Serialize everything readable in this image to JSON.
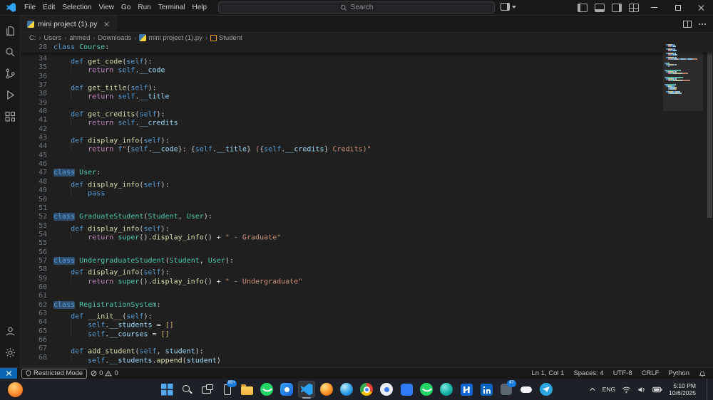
{
  "titlebar": {
    "menus": [
      "File",
      "Edit",
      "Selection",
      "View",
      "Go",
      "Run",
      "Terminal",
      "Help"
    ],
    "search_placeholder": "Search"
  },
  "tab": {
    "label": "mini project (1).py"
  },
  "breadcrumbs": {
    "items": [
      {
        "label": "C:"
      },
      {
        "label": "Users"
      },
      {
        "label": "ahmed"
      },
      {
        "label": "Downloads"
      },
      {
        "label": "mini project (1).py",
        "icon": "python"
      },
      {
        "label": "Student",
        "icon": "class"
      }
    ]
  },
  "editor": {
    "token_colors": {
      "kw": "#569cd6",
      "ret": "#c586c0",
      "cls": "#4ec9b0",
      "fn": "#dcdcaa",
      "sv": "#569cd6",
      "va": "#9cdcfe",
      "st": "#ce9178",
      "pu": "#cccccc",
      "op": "#d4d4d4",
      "bk": "#d9b879",
      "hl": "#569cd6"
    },
    "sticky": {
      "n": 28,
      "t": [
        [
          "kw",
          "class "
        ],
        [
          "cls",
          "Course"
        ],
        [
          "pu",
          ":"
        ]
      ]
    },
    "lines": [
      {
        "n": 34,
        "t": [
          [
            "ind",
            1
          ],
          [
            "kw",
            "def "
          ],
          [
            "fn",
            "get_code"
          ],
          [
            "pu",
            "("
          ],
          [
            "sv",
            "self"
          ],
          [
            "pu",
            "):"
          ]
        ]
      },
      {
        "n": 35,
        "t": [
          [
            "ind",
            2
          ],
          [
            "ret",
            "return "
          ],
          [
            "sv",
            "self"
          ],
          [
            "pu",
            "."
          ],
          [
            "va",
            "__code"
          ]
        ]
      },
      {
        "n": 36,
        "t": []
      },
      {
        "n": 37,
        "t": [
          [
            "ind",
            1
          ],
          [
            "kw",
            "def "
          ],
          [
            "fn",
            "get_title"
          ],
          [
            "pu",
            "("
          ],
          [
            "sv",
            "self"
          ],
          [
            "pu",
            "):"
          ]
        ]
      },
      {
        "n": 38,
        "t": [
          [
            "ind",
            2
          ],
          [
            "ret",
            "return "
          ],
          [
            "sv",
            "self"
          ],
          [
            "pu",
            "."
          ],
          [
            "va",
            "__title"
          ]
        ]
      },
      {
        "n": 39,
        "t": []
      },
      {
        "n": 40,
        "t": [
          [
            "ind",
            1
          ],
          [
            "kw",
            "def "
          ],
          [
            "fn",
            "get_credits"
          ],
          [
            "pu",
            "("
          ],
          [
            "sv",
            "self"
          ],
          [
            "pu",
            "):"
          ]
        ]
      },
      {
        "n": 41,
        "t": [
          [
            "ind",
            2
          ],
          [
            "ret",
            "return "
          ],
          [
            "sv",
            "self"
          ],
          [
            "pu",
            "."
          ],
          [
            "va",
            "__credits"
          ]
        ]
      },
      {
        "n": 42,
        "t": []
      },
      {
        "n": 43,
        "t": [
          [
            "ind",
            1
          ],
          [
            "kw",
            "def "
          ],
          [
            "fn",
            "display_info"
          ],
          [
            "pu",
            "("
          ],
          [
            "sv",
            "self"
          ],
          [
            "pu",
            "):"
          ]
        ]
      },
      {
        "n": 44,
        "t": [
          [
            "ind",
            2
          ],
          [
            "ret",
            "return "
          ],
          [
            "kw",
            "f"
          ],
          [
            "st",
            "\""
          ],
          [
            "pu",
            "{"
          ],
          [
            "sv",
            "self"
          ],
          [
            "pu",
            "."
          ],
          [
            "va",
            "__code"
          ],
          [
            "pu",
            "}"
          ],
          [
            "st",
            ": "
          ],
          [
            "pu",
            "{"
          ],
          [
            "sv",
            "self"
          ],
          [
            "pu",
            "."
          ],
          [
            "va",
            "__title"
          ],
          [
            "pu",
            "}"
          ],
          [
            "st",
            " ("
          ],
          [
            "pu",
            "{"
          ],
          [
            "sv",
            "self"
          ],
          [
            "pu",
            "."
          ],
          [
            "va",
            "__credits"
          ],
          [
            "pu",
            "}"
          ],
          [
            "st",
            " Credits)\""
          ]
        ]
      },
      {
        "n": 45,
        "t": []
      },
      {
        "n": 46,
        "t": []
      },
      {
        "n": 47,
        "t": [
          [
            "hl",
            "class"
          ],
          [
            "pu",
            " "
          ],
          [
            "cls",
            "User"
          ],
          [
            "pu",
            ":"
          ]
        ]
      },
      {
        "n": 48,
        "t": [
          [
            "ind",
            1
          ],
          [
            "kw",
            "def "
          ],
          [
            "fn",
            "display_info"
          ],
          [
            "pu",
            "("
          ],
          [
            "sv",
            "self"
          ],
          [
            "pu",
            "):"
          ]
        ]
      },
      {
        "n": 49,
        "t": [
          [
            "ind",
            2
          ],
          [
            "kw",
            "pass"
          ]
        ]
      },
      {
        "n": 50,
        "t": []
      },
      {
        "n": 51,
        "t": []
      },
      {
        "n": 52,
        "t": [
          [
            "hl",
            "class"
          ],
          [
            "pu",
            " "
          ],
          [
            "cls",
            "GraduateStudent"
          ],
          [
            "pu",
            "("
          ],
          [
            "cls",
            "Student"
          ],
          [
            "pu",
            ", "
          ],
          [
            "cls",
            "User"
          ],
          [
            "pu",
            "):"
          ]
        ]
      },
      {
        "n": 53,
        "t": [
          [
            "ind",
            1
          ],
          [
            "kw",
            "def "
          ],
          [
            "fn",
            "display_info"
          ],
          [
            "pu",
            "("
          ],
          [
            "sv",
            "self"
          ],
          [
            "pu",
            "):"
          ]
        ]
      },
      {
        "n": 54,
        "t": [
          [
            "ind",
            2
          ],
          [
            "ret",
            "return "
          ],
          [
            "cls",
            "super"
          ],
          [
            "pu",
            "()."
          ],
          [
            "fn",
            "display_info"
          ],
          [
            "pu",
            "() "
          ],
          [
            "op",
            "+ "
          ],
          [
            "st",
            "\" - Graduate\""
          ]
        ]
      },
      {
        "n": 55,
        "t": []
      },
      {
        "n": 56,
        "t": []
      },
      {
        "n": 57,
        "t": [
          [
            "hl",
            "class"
          ],
          [
            "pu",
            " "
          ],
          [
            "cls",
            "UndergraduateStudent"
          ],
          [
            "pu",
            "("
          ],
          [
            "cls",
            "Student"
          ],
          [
            "pu",
            ", "
          ],
          [
            "cls",
            "User"
          ],
          [
            "pu",
            "):"
          ]
        ]
      },
      {
        "n": 58,
        "t": [
          [
            "ind",
            1
          ],
          [
            "kw",
            "def "
          ],
          [
            "fn",
            "display_info"
          ],
          [
            "pu",
            "("
          ],
          [
            "sv",
            "self"
          ],
          [
            "pu",
            "):"
          ]
        ]
      },
      {
        "n": 59,
        "t": [
          [
            "ind",
            2
          ],
          [
            "ret",
            "return "
          ],
          [
            "cls",
            "super"
          ],
          [
            "pu",
            "()."
          ],
          [
            "fn",
            "display_info"
          ],
          [
            "pu",
            "() "
          ],
          [
            "op",
            "+ "
          ],
          [
            "st",
            "\" - Undergraduate\""
          ]
        ]
      },
      {
        "n": 60,
        "t": []
      },
      {
        "n": 61,
        "t": []
      },
      {
        "n": 62,
        "t": [
          [
            "hl",
            "class"
          ],
          [
            "pu",
            " "
          ],
          [
            "cls",
            "RegistrationSystem"
          ],
          [
            "pu",
            ":"
          ]
        ]
      },
      {
        "n": 63,
        "t": [
          [
            "ind",
            1
          ],
          [
            "kw",
            "def "
          ],
          [
            "fn",
            "__init__"
          ],
          [
            "pu",
            "("
          ],
          [
            "sv",
            "self"
          ],
          [
            "pu",
            "):"
          ]
        ]
      },
      {
        "n": 64,
        "t": [
          [
            "ind",
            2
          ],
          [
            "sv",
            "self"
          ],
          [
            "pu",
            "."
          ],
          [
            "va",
            "__students"
          ],
          [
            "op",
            " = "
          ],
          [
            "bk",
            "[]"
          ]
        ]
      },
      {
        "n": 65,
        "t": [
          [
            "ind",
            2
          ],
          [
            "sv",
            "self"
          ],
          [
            "pu",
            "."
          ],
          [
            "va",
            "__courses"
          ],
          [
            "op",
            " = "
          ],
          [
            "bk",
            "[]"
          ]
        ]
      },
      {
        "n": 66,
        "t": []
      },
      {
        "n": 67,
        "t": [
          [
            "ind",
            1
          ],
          [
            "kw",
            "def "
          ],
          [
            "fn",
            "add_student"
          ],
          [
            "pu",
            "("
          ],
          [
            "sv",
            "self"
          ],
          [
            "pu",
            ", "
          ],
          [
            "va",
            "student"
          ],
          [
            "pu",
            "):"
          ]
        ]
      },
      {
        "n": 68,
        "t": [
          [
            "ind",
            2
          ],
          [
            "sv",
            "self"
          ],
          [
            "pu",
            "."
          ],
          [
            "va",
            "__students"
          ],
          [
            "pu",
            "."
          ],
          [
            "fn",
            "append"
          ],
          [
            "pu",
            "("
          ],
          [
            "va",
            "student"
          ],
          [
            "pu",
            ")"
          ]
        ]
      }
    ]
  },
  "status_bar": {
    "restricted_label": "Restricted Mode",
    "errors": "0",
    "warnings": "0",
    "line_col": "Ln 1, Col 1",
    "spaces": "Spaces: 4",
    "encoding": "UTF-8",
    "eol": "CRLF",
    "language": "Python"
  },
  "taskbar": {
    "apps": [
      {
        "name": "start"
      },
      {
        "name": "search"
      },
      {
        "name": "task-view"
      },
      {
        "name": "phone-link",
        "badge": "99+"
      },
      {
        "name": "file-explorer"
      },
      {
        "name": "whatsapp"
      },
      {
        "name": "app-blue"
      },
      {
        "name": "vscode",
        "active": true
      },
      {
        "name": "app-candy"
      },
      {
        "name": "app-sphere"
      },
      {
        "name": "chrome"
      },
      {
        "name": "app-light"
      },
      {
        "name": "app-square-blue"
      },
      {
        "name": "whatsapp-2"
      },
      {
        "name": "app-teal"
      },
      {
        "name": "app-n"
      },
      {
        "name": "linkedin"
      },
      {
        "name": "app-gray",
        "badge": "47"
      },
      {
        "name": "app-pill"
      },
      {
        "name": "telegram"
      }
    ],
    "tray": {
      "language": "ENG",
      "time": "5:10 PM",
      "date": "10/6/2025"
    }
  },
  "accent_colors": {
    "titlebar_bg": "#181818",
    "editor_bg": "#1f1f1f",
    "remote_bg": "#0866b3",
    "taskbar_bg": "#1d2026"
  }
}
